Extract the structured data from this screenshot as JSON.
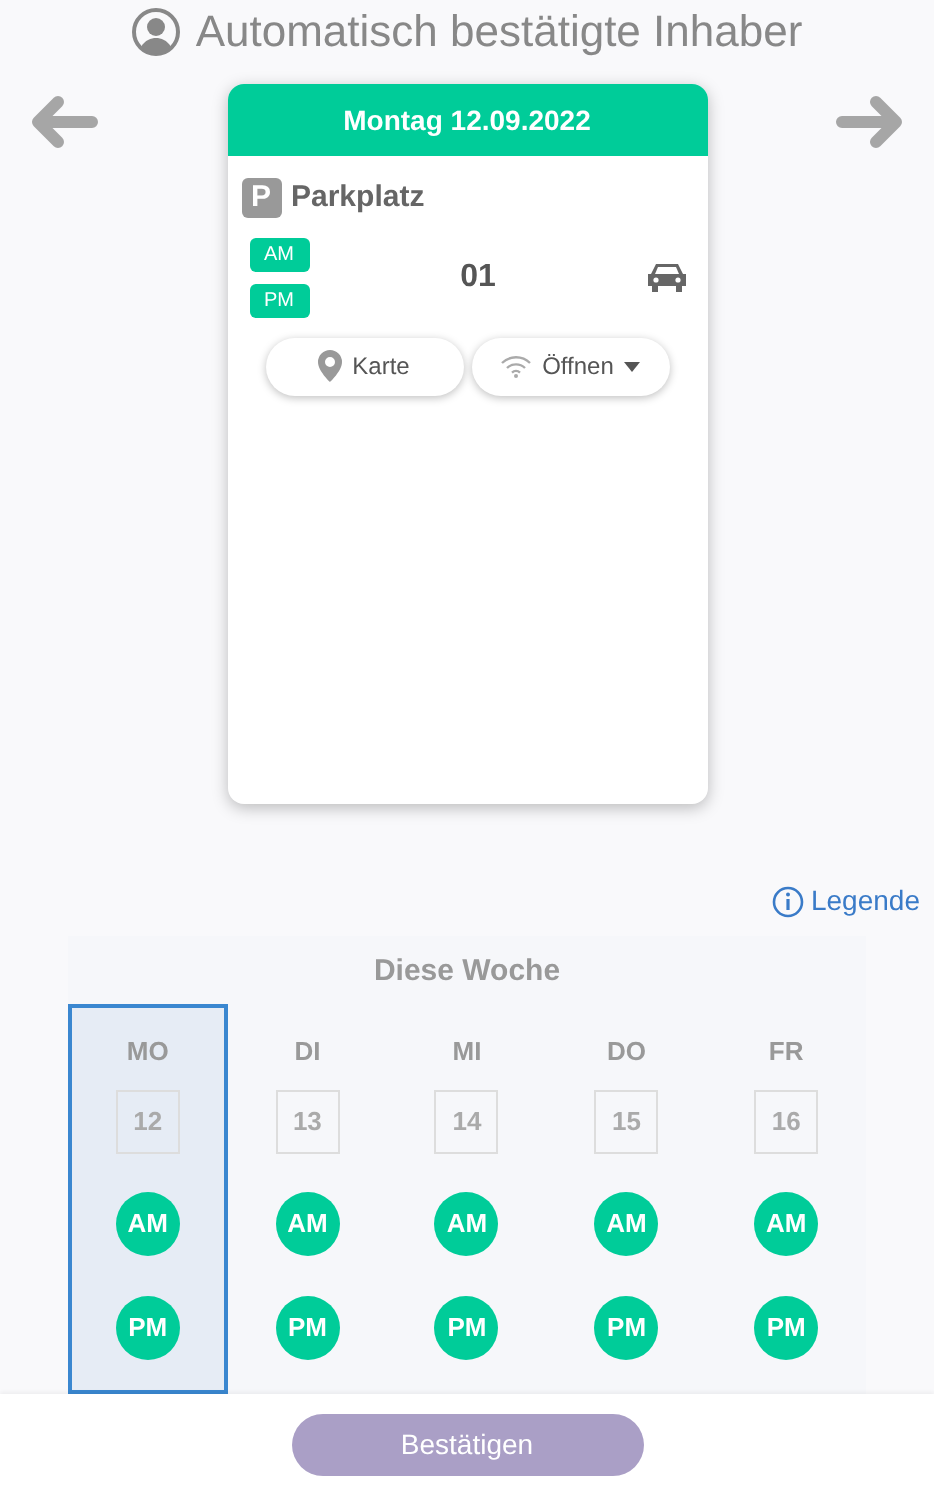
{
  "title": "Automatisch bestätigte Inhaber",
  "card": {
    "date": "Montag 12.09.2022",
    "location": "Parkplatz",
    "location_icon": "P",
    "slots": [
      "AM",
      "PM"
    ],
    "spot": "01",
    "buttons": [
      {
        "label": "Karte",
        "kind": "map"
      },
      {
        "label": "Öffnen",
        "kind": "open"
      }
    ]
  },
  "legend": "Legende",
  "week": {
    "title": "Diese Woche",
    "days": [
      {
        "name": "MO",
        "date": "12",
        "selected": true,
        "slots": [
          "AM",
          "PM"
        ]
      },
      {
        "name": "DI",
        "date": "13",
        "selected": false,
        "slots": [
          "AM",
          "PM"
        ]
      },
      {
        "name": "MI",
        "date": "14",
        "selected": false,
        "slots": [
          "AM",
          "PM"
        ]
      },
      {
        "name": "DO",
        "date": "15",
        "selected": false,
        "slots": [
          "AM",
          "PM"
        ]
      },
      {
        "name": "FR",
        "date": "16",
        "selected": false,
        "slots": [
          "AM",
          "PM"
        ]
      }
    ]
  },
  "confirm_button": "Bestätigen"
}
